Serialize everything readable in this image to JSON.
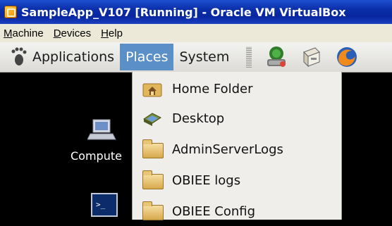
{
  "window": {
    "title": "SampleApp_V107 [Running] - Oracle VM VirtualBox"
  },
  "host_menu": {
    "items": [
      "Machine",
      "Devices",
      "Help"
    ]
  },
  "panel": {
    "menus": [
      "Applications",
      "Places",
      "System"
    ],
    "active_menu": "Places",
    "launchers": [
      "network-icon",
      "file-cabinet-icon",
      "firefox-icon"
    ]
  },
  "desktop": {
    "icons": [
      {
        "label": "Compute",
        "icon": "computer-icon"
      },
      {
        "label": "",
        "icon": "terminal-icon"
      }
    ]
  },
  "places_menu": {
    "items": [
      {
        "label": "Home Folder",
        "icon": "home-folder-icon"
      },
      {
        "label": "Desktop",
        "icon": "desktop-icon"
      },
      {
        "label": "AdminServerLogs",
        "icon": "folder-icon"
      },
      {
        "label": "OBIEE logs",
        "icon": "folder-icon"
      },
      {
        "label": "OBIEE Config",
        "icon": "folder-icon"
      }
    ]
  },
  "colors": {
    "titlebar": "#0a2ea8",
    "active_menu": "#5a8fc7",
    "menu_bg": "#efeeeb"
  }
}
